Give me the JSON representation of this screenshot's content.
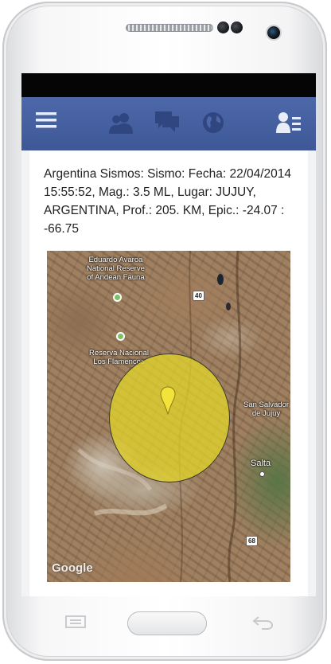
{
  "appbar": {
    "icons": [
      "menu-icon",
      "friends-icon",
      "messages-icon",
      "globe-icon",
      "profile-list-icon"
    ]
  },
  "post": {
    "text": "Argentina Sismos: Sismo: Fecha: 22/04/2014 15:55:52, Mag.: 3.5 ML, Lugar: JUJUY, ARGENTINA, Prof.: 205. KM, Epic.: -24.07 : -66.75"
  },
  "map": {
    "labels": {
      "reserve_andean": "Eduardo Avaroa\nNational Reserve\nof Andean Fauna",
      "flamencos": "Reserva Nacional\nLos Flamencos",
      "san_salvador": "San Salvador\nde Jujuy",
      "salta": "Salta"
    },
    "roads": {
      "r40": "40",
      "r68": "68"
    },
    "attribution": "Google",
    "overlay_color": "#e8da28"
  }
}
